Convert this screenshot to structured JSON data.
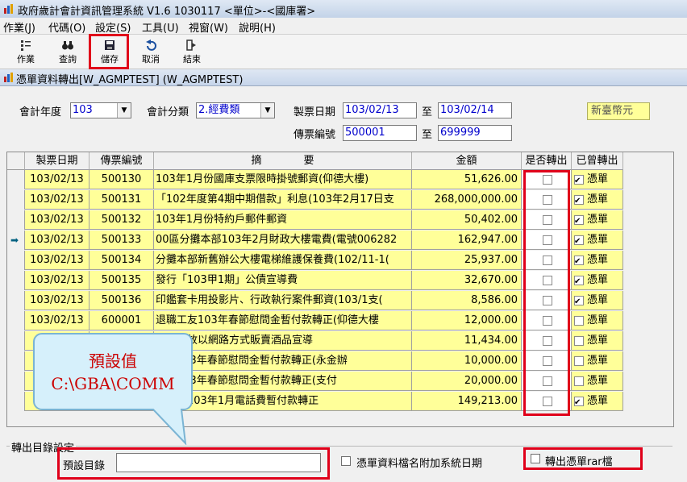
{
  "window": {
    "title": "政府歲計會計資訊管理系統 V1.6  1030117 <單位>-<國庫署>"
  },
  "menu": [
    "作業(J)",
    "代碼(O)",
    "設定(S)",
    "工具(U)",
    "視窗(W)",
    "說明(H)"
  ],
  "toolbar": [
    {
      "label": "作業",
      "icon": "tasks-icon"
    },
    {
      "label": "查詢",
      "icon": "binoculars-icon"
    },
    {
      "label": "儲存",
      "icon": "floppy-save-icon"
    },
    {
      "label": "取消",
      "icon": "undo-icon"
    },
    {
      "label": "結束",
      "icon": "exit-icon"
    }
  ],
  "subwindow": {
    "title": "憑單資料轉出[W_AGMPTEST] (W_AGMPTEST)"
  },
  "filters": {
    "fiscal_year_label": "會計年度",
    "fiscal_year_value": "103",
    "category_label": "會計分類",
    "category_value": "2.經費類",
    "date_label": "製票日期",
    "date_from": "103/02/13",
    "date_to": "103/02/14",
    "to_label": "至",
    "voucher_label": "傳票編號",
    "voucher_from": "500001",
    "voucher_to": "699999",
    "currency": "新臺幣元"
  },
  "grid": {
    "headers": [
      "製票日期",
      "傳票編號",
      "摘　　　　要",
      "金額",
      "是否轉出",
      "已曾轉出"
    ],
    "rows": [
      {
        "date": "103/02/13",
        "no": "500130",
        "summary": "103年1月份國庫支票限時掛號郵資(仰德大樓)",
        "amount": "51,626.00",
        "converted": false,
        "done": true,
        "done_label": "憑單"
      },
      {
        "date": "103/02/13",
        "no": "500131",
        "summary": "「102年度第4期中期借款」利息(103年2月17日支",
        "amount": "268,000,000.00",
        "converted": false,
        "done": true,
        "done_label": "憑單"
      },
      {
        "date": "103/02/13",
        "no": "500132",
        "summary": "103年1月份特約戶郵件郵資",
        "amount": "50,402.00",
        "converted": false,
        "done": true,
        "done_label": "憑單"
      },
      {
        "date": "103/02/13",
        "no": "500133",
        "summary": "00區分攤本部103年2月財政大樓電費(電號006282",
        "amount": "162,947.00",
        "converted": false,
        "done": true,
        "done_label": "憑單"
      },
      {
        "date": "103/02/13",
        "no": "500134",
        "summary": "分攤本部新舊辦公大樓電梯維護保養費(102/11-1(",
        "amount": "25,937.00",
        "converted": false,
        "done": true,
        "done_label": "憑單"
      },
      {
        "date": "103/02/13",
        "no": "500135",
        "summary": "發行「103甲1期」公債宣導費",
        "amount": "32,670.00",
        "converted": false,
        "done": true,
        "done_label": "憑單"
      },
      {
        "date": "103/02/13",
        "no": "500136",
        "summary": "印鑑套卡用投影片、行政執行案件郵資(103/1支(",
        "amount": "8,586.00",
        "converted": false,
        "done": true,
        "done_label": "憑單"
      },
      {
        "date": "103/02/13",
        "no": "600001",
        "summary": "退職工友103年春節慰問金暫付款轉正(仰德大樓",
        "amount": "12,000.00",
        "converted": false,
        "done": false,
        "done_label": "憑單"
      },
      {
        "date": "",
        "no": "",
        "summary": "宜否開放以網路方式販賣酒品宣導",
        "amount": "11,434.00",
        "converted": false,
        "done": false,
        "done_label": "憑單"
      },
      {
        "date": "",
        "no": "",
        "summary": "工友103年春節慰問金暫付款轉正(永金辦",
        "amount": "10,000.00",
        "converted": false,
        "done": false,
        "done_label": "憑單"
      },
      {
        "date": "",
        "no": "",
        "summary": "工友103年春節慰問金暫付款轉正(支付",
        "amount": "20,000.00",
        "converted": false,
        "done": false,
        "done_label": "憑單"
      },
      {
        "date": "",
        "no": "",
        "summary": "付大樓103年1月電話費暫付款轉正",
        "amount": "149,213.00",
        "converted": false,
        "done": true,
        "done_label": "憑單"
      }
    ]
  },
  "output": {
    "group_label": "轉出目錄設定",
    "dir_label": "預設目錄",
    "dir_value": "",
    "append_date_label": "憑單資料檔名附加系統日期",
    "rar_label": "轉出憑單rar檔"
  },
  "callout": {
    "line1": "預設值",
    "line2": "C:\\GBA\\COMM"
  },
  "colors": {
    "highlight_red": "#e0001a",
    "row_yellow": "#ffff99",
    "callout_fill": "#d6f0fb",
    "callout_text": "#cc0000"
  }
}
